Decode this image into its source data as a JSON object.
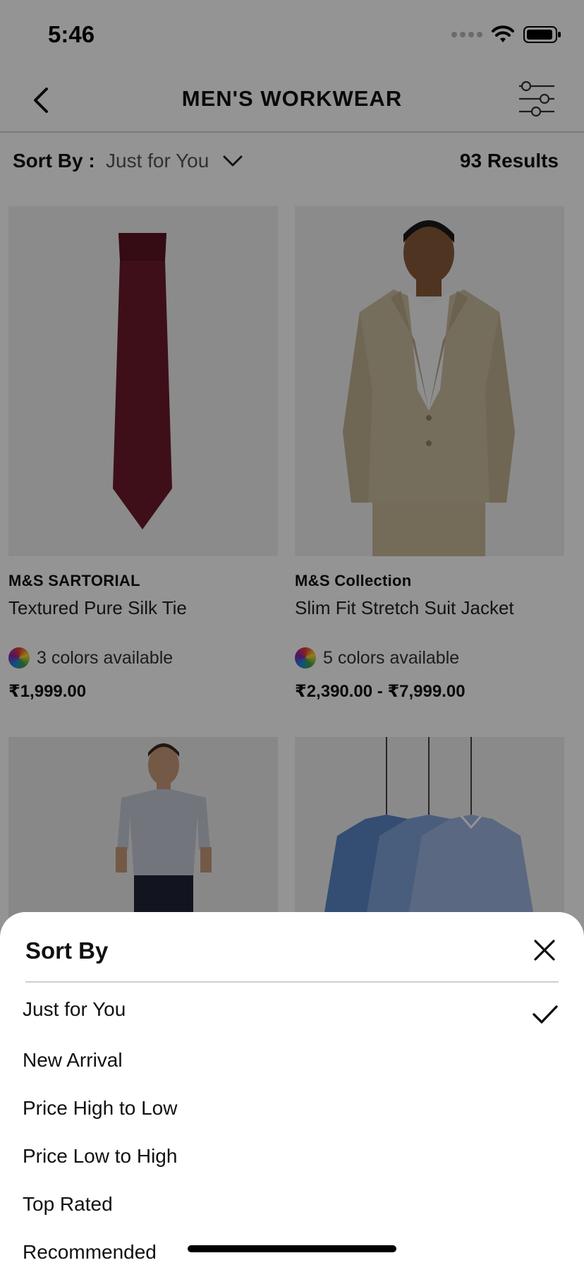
{
  "status_bar": {
    "time": "5:46"
  },
  "header": {
    "title": "MEN'S WORKWEAR"
  },
  "sort_bar": {
    "label": "Sort By :",
    "value": "Just for You",
    "results": "93 Results"
  },
  "products": [
    {
      "brand": "M&S SARTORIAL",
      "name": "Textured Pure Silk Tie",
      "colors": "3 colors available",
      "price": "₹1,999.00"
    },
    {
      "brand": "M&S Collection",
      "name": "Slim Fit Stretch Suit Jacket",
      "colors": "5 colors available",
      "price": "₹2,390.00 - ₹7,999.00"
    }
  ],
  "sort_sheet": {
    "title": "Sort By",
    "options": [
      "Just for You",
      "New Arrival",
      "Price High to Low",
      "Price Low to High",
      "Top Rated",
      "Recommended"
    ],
    "selected": "Just for You"
  },
  "icons": {
    "back": "chevron-left-icon",
    "filter": "sliders-icon",
    "sort_toggle": "chevron-down-icon",
    "color_swatch": "color-wheel-icon",
    "close": "close-icon",
    "selected": "checkmark-icon"
  }
}
